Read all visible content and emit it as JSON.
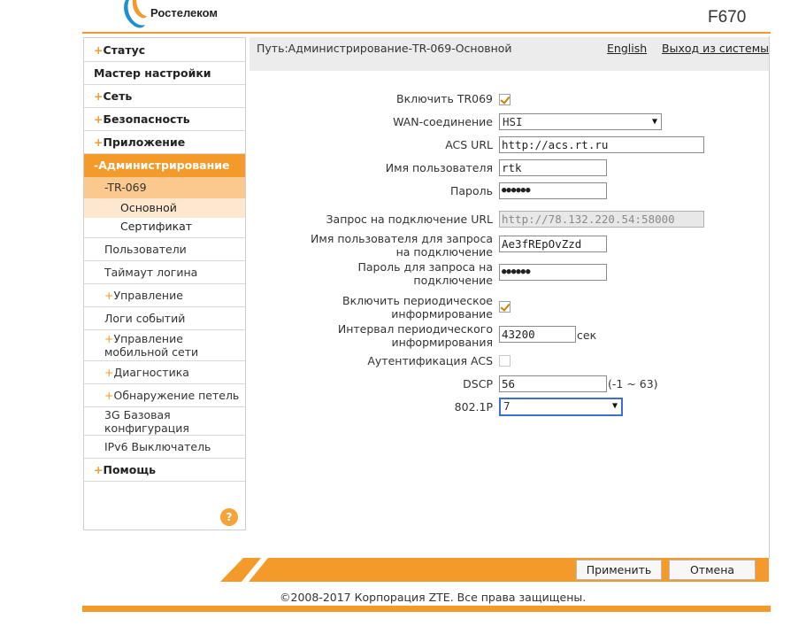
{
  "header": {
    "brand": "Ростелеком",
    "model": "F670"
  },
  "colors": {
    "accent": "#f39a2b",
    "active_sub": "#fbc98d",
    "leaf_bg": "#fde7cf"
  },
  "sidebar": {
    "status": "Статус",
    "wizard": "Мастер настройки",
    "network": "Сеть",
    "security": "Безопасность",
    "application": "Приложение",
    "administration": "Администрирование",
    "tr069": "TR-069",
    "tr069_basic": "Основной",
    "tr069_cert": "Сертификат",
    "users": "Пользователи",
    "login_timeout": "Таймаут логина",
    "management": "Управление",
    "event_logs": "Логи событий",
    "mobile_mgmt": "Управление мобильной сети",
    "diagnostics": "Диагностика",
    "loop_detect": "Обнаружение петель",
    "g3_config": "3G Базовая конфигурация",
    "ipv6_switch": "IPv6 Выключатель",
    "help": "Помощь",
    "plus_sign": "+",
    "minus_sign": "-",
    "help_icon": "?"
  },
  "breadcrumb": {
    "path": "Путь:Администрирование-TR-069-Основной",
    "language": "English",
    "logout": "Выход из системы"
  },
  "form": {
    "enable_tr069": {
      "label": "Включить TR069",
      "checked": true
    },
    "wan": {
      "label": "WAN-соединение",
      "value": "HSI"
    },
    "acs_url": {
      "label": "ACS URL",
      "value": "http://acs.rt.ru"
    },
    "username": {
      "label": "Имя пользователя",
      "value": "rtk"
    },
    "password": {
      "label": "Пароль",
      "value": "●●●●●●"
    },
    "conn_req_url": {
      "label": "Запрос на подключение URL",
      "value": "http://78.132.220.54:58000"
    },
    "conn_req_user": {
      "label": "Имя пользователя для запроса на подключение",
      "value": "Ae3fREpOvZzd"
    },
    "conn_req_pass": {
      "label": "Пароль для запроса на подключение",
      "value": "●●●●●●"
    },
    "periodic_inform": {
      "label": "Включить периодическое информирование",
      "checked": true
    },
    "inform_interval": {
      "label": "Интервал периодического информирования",
      "value": "43200",
      "unit": "сек"
    },
    "acs_auth": {
      "label": "Аутентификация ACS",
      "checked": false
    },
    "dscp": {
      "label": "DSCP",
      "value": "56",
      "range": "(-1 ~ 63)"
    },
    "p8021": {
      "label": "802.1P",
      "value": "7"
    }
  },
  "buttons": {
    "apply": "Применить",
    "cancel": "Отмена"
  },
  "footer": {
    "copyright": "©2008-2017 Корпорация ZTE. Все права защищены."
  }
}
